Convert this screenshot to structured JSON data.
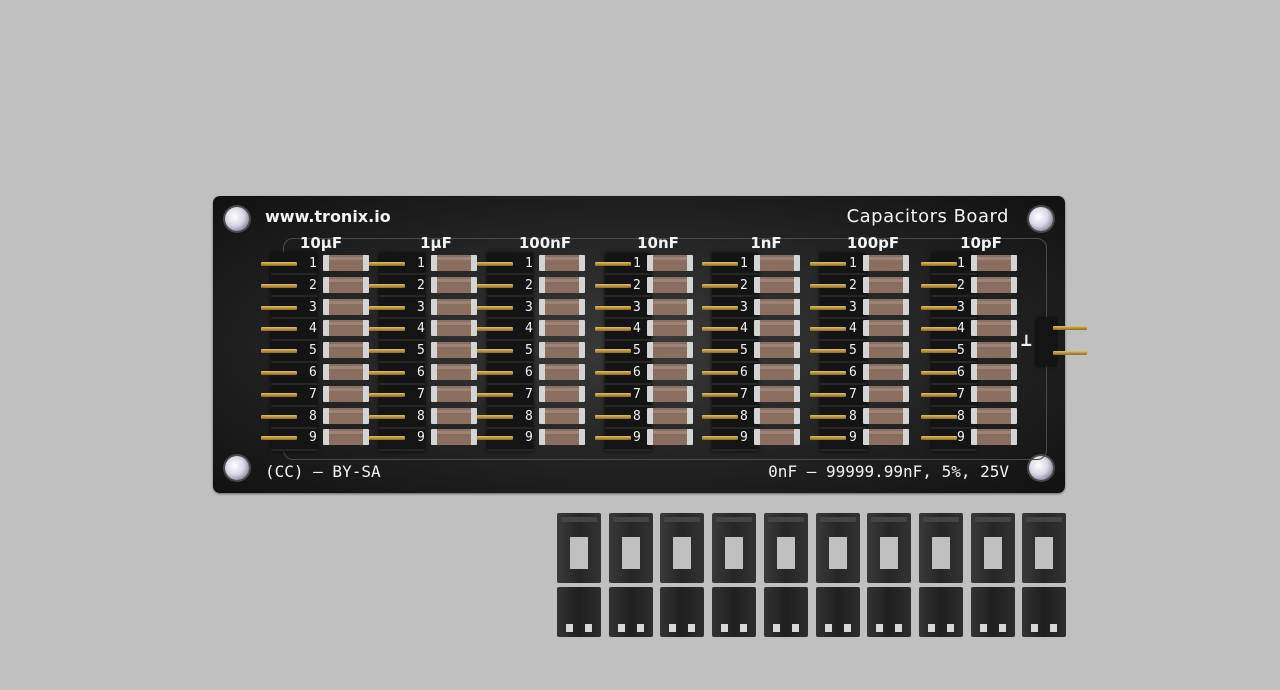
{
  "board": {
    "url": "www.tronix.io",
    "title": "Capacitors Board",
    "license": "(CC) – BY-SA",
    "spec": "0nF – 99999.99nF, 5%, 25V",
    "connector_symbol": "⊥"
  },
  "groups": [
    {
      "label": "10µF"
    },
    {
      "label": "1µF"
    },
    {
      "label": "100nF"
    },
    {
      "label": "10nF"
    },
    {
      "label": "1nF"
    },
    {
      "label": "100pF"
    },
    {
      "label": "10pF"
    }
  ],
  "positions": [
    "1",
    "2",
    "3",
    "4",
    "5",
    "6",
    "7",
    "8",
    "9"
  ],
  "jumpers": {
    "count": 10
  }
}
